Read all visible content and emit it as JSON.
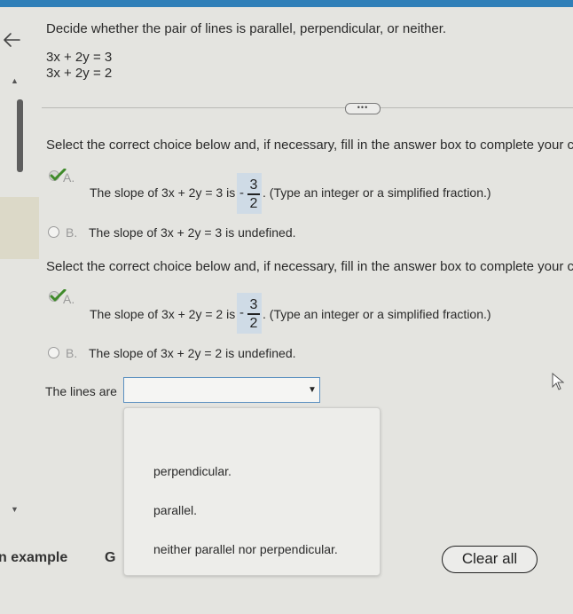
{
  "header": {
    "instruction": "Decide whether the pair of lines is parallel, perpendicular, or neither."
  },
  "equations": {
    "line1": "3x + 2y = 3",
    "line2": "3x + 2y = 2"
  },
  "section1": {
    "prompt": "Select the correct choice below and, if necessary, fill in the answer box to complete your choic",
    "choice_a": {
      "letter": "A.",
      "text_before": "The slope of 3x + 2y = 3 is",
      "answer": {
        "sign": "-",
        "numerator": "3",
        "denominator": "2"
      },
      "text_after": ". (Type an integer or a simplified fraction.)"
    },
    "choice_b": {
      "letter": "B.",
      "text": "The slope of 3x + 2y = 3 is undefined."
    }
  },
  "section2": {
    "prompt": "Select the correct choice below and, if necessary, fill in the answer box to complete your choic",
    "choice_a": {
      "letter": "A.",
      "text_before": "The slope of 3x + 2y = 2 is",
      "answer": {
        "sign": "-",
        "numerator": "3",
        "denominator": "2"
      },
      "text_after": ". (Type an integer or a simplified fraction.)"
    },
    "choice_b": {
      "letter": "B.",
      "text": "The slope of 3x + 2y = 2 is undefined."
    }
  },
  "lines_label": "The lines are",
  "dropdown": {
    "value": "",
    "options": [
      "perpendicular.",
      "parallel.",
      "neither parallel nor perpendicular."
    ]
  },
  "footer": {
    "example_link": "n example",
    "get_link": "G",
    "clear_all": "Clear all"
  },
  "colors": {
    "accent": "#2f7fb8",
    "check_green": "#3f8a2a",
    "answer_box": "#cfdbe6"
  }
}
